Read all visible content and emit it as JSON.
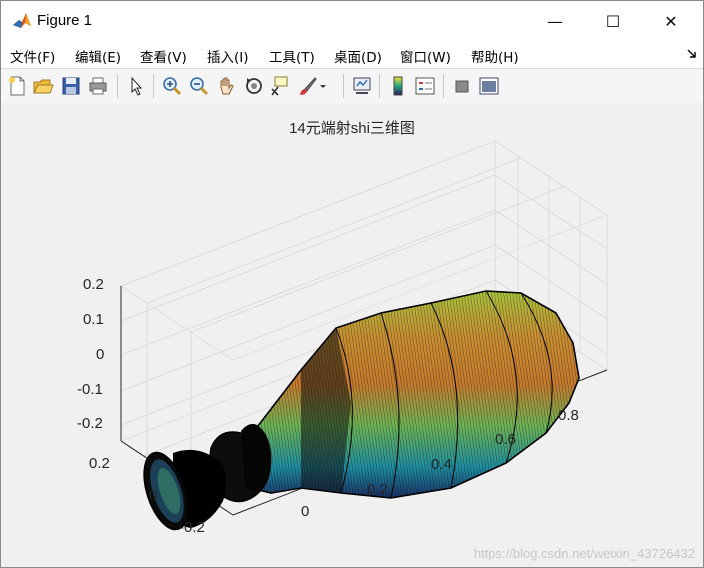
{
  "window": {
    "title": "Figure 1",
    "controls": {
      "minimize": "—",
      "maximize": "☐",
      "close": "✕"
    }
  },
  "menu": {
    "items": [
      "文件(F)",
      "编辑(E)",
      "查看(V)",
      "插入(I)",
      "工具(T)",
      "桌面(D)",
      "窗口(W)",
      "帮助(H)"
    ],
    "overflow_icon": "dock-arrow-icon"
  },
  "toolbar": {
    "buttons": [
      "new-figure-icon",
      "open-file-icon",
      "save-icon",
      "print-icon",
      "select-arrow-icon",
      "zoom-in-icon",
      "zoom-out-icon",
      "pan-hand-icon",
      "rotate-3d-icon",
      "data-cursor-icon",
      "brush-icon",
      "link-plot-icon",
      "colorbar-icon",
      "legend-icon",
      "hide-plot-tools-icon",
      "show-plot-tools-icon"
    ]
  },
  "plot": {
    "title": "14元端射shi三维图",
    "z_ticks": [
      "0.2",
      "0.1",
      "0",
      "-0.1",
      "-0.2"
    ],
    "y_ticks": [
      "0.2",
      "0",
      "-0.2"
    ],
    "x_ticks": [
      "0",
      "0.2",
      "0.4",
      "0.6",
      "0.8"
    ],
    "colormap": [
      "#2b1a5e",
      "#1f6fa8",
      "#22a67f",
      "#8cc83c",
      "#e0b83a",
      "#c97a2e"
    ]
  },
  "watermark": "https://blog.csdn.net/weixin_43726432"
}
